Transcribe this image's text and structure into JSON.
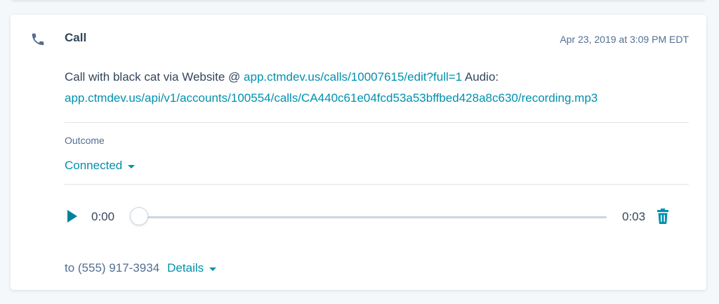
{
  "engagement": {
    "type_label": "Call",
    "type_icon": "phone-icon",
    "timestamp": "Apr 23, 2019 at 3:09 PM EDT",
    "body": {
      "prefix": "Call with black cat via Website @ ",
      "edit_link": "app.ctmdev.us/calls/10007615/edit?full=1",
      "audio_label": " Audio: ",
      "recording_link": "app.ctmdev.us/api/v1/accounts/100554/calls/CA440c61e04fcd53a53bffbed428a8c630/recording.mp3"
    },
    "outcome": {
      "label": "Outcome",
      "value": "Connected"
    },
    "player": {
      "current_time": "0:00",
      "total_time": "0:03",
      "progress": 0,
      "play_icon": "play-icon",
      "delete_icon": "trash-icon"
    },
    "footer": {
      "to_text": "to (555) 917-3934",
      "details_label": "Details"
    }
  },
  "colors": {
    "accent": "#0091ae",
    "text": "#33475b",
    "muted": "#516f90",
    "divider": "#dfe3eb",
    "background": "#f5f8fa"
  }
}
